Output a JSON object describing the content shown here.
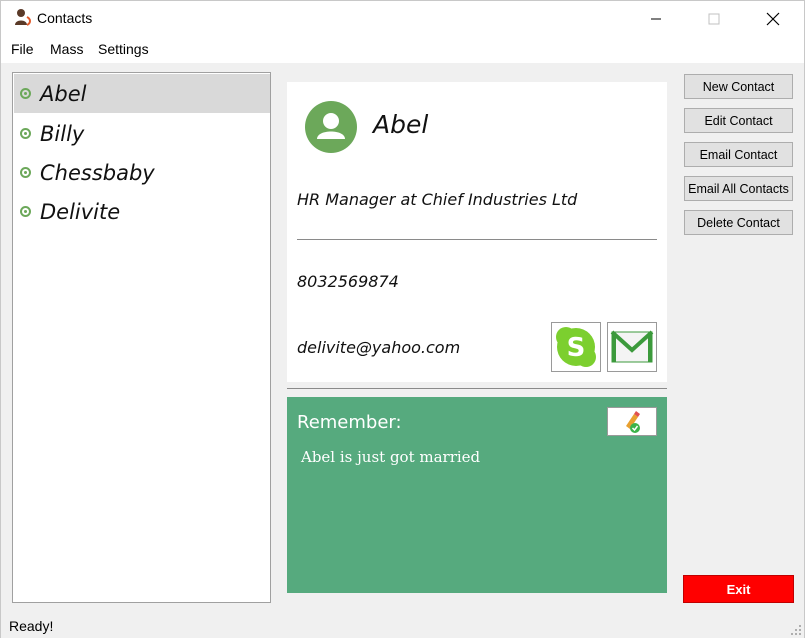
{
  "window": {
    "title": "Contacts"
  },
  "menu": {
    "items": [
      "File",
      "Mass",
      "Settings"
    ]
  },
  "contacts": [
    {
      "name": "Abel",
      "selected": true
    },
    {
      "name": "Billy",
      "selected": false
    },
    {
      "name": "Chessbaby",
      "selected": false
    },
    {
      "name": "Delivite",
      "selected": false
    }
  ],
  "detail": {
    "name": "Abel",
    "title": "HR Manager at Chief Industries Ltd",
    "phone": "8032569874",
    "email": "delivite@yahoo.com",
    "skype_icon": "skype-icon",
    "mail_icon": "gmail-icon"
  },
  "remember": {
    "label": "Remember:",
    "note": "Abel is just got married",
    "edit_icon": "pencil-check-icon"
  },
  "actions": {
    "new_contact": "New Contact",
    "edit_contact": "Edit Contact",
    "email_contact": "Email Contact",
    "email_all": "Email All Contacts",
    "delete_contact": "Delete Contact",
    "exit": "Exit"
  },
  "status": {
    "text": "Ready!"
  },
  "colors": {
    "accent_green": "#56aa7e",
    "avatar_green": "#6ca85a",
    "exit_red": "#ff0000"
  }
}
